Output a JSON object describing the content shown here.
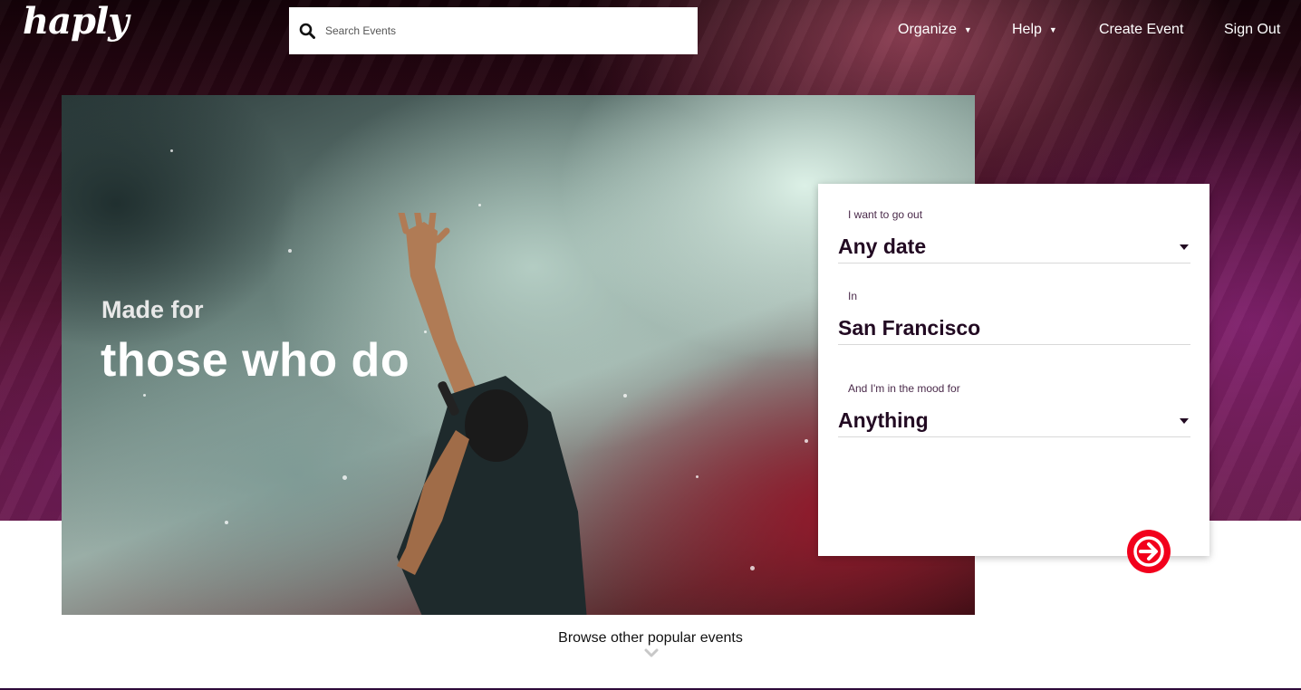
{
  "header": {
    "logo": "haply",
    "search": {
      "placeholder": "Search Events",
      "value": ""
    },
    "nav": [
      {
        "label": "Organize",
        "has_dropdown": true
      },
      {
        "label": "Help",
        "has_dropdown": true
      },
      {
        "label": "Create Event",
        "has_dropdown": false
      },
      {
        "label": "Sign Out",
        "has_dropdown": false
      }
    ]
  },
  "hero": {
    "tagline_small": "Made for",
    "tagline_big": "those who do"
  },
  "form": {
    "date_label": "I want to go out",
    "date_value": "Any date",
    "location_label": "In",
    "location_value": "San Francisco",
    "mood_label": "And I'm in the mood for",
    "mood_value": "Anything"
  },
  "browse": {
    "label": "Browse other popular events"
  },
  "colors": {
    "accent": "#f2001c",
    "text_dark": "#220a22"
  },
  "icons": {
    "search": "search-icon",
    "go": "arrow-right-icon",
    "browse": "chevron-down-icon"
  }
}
